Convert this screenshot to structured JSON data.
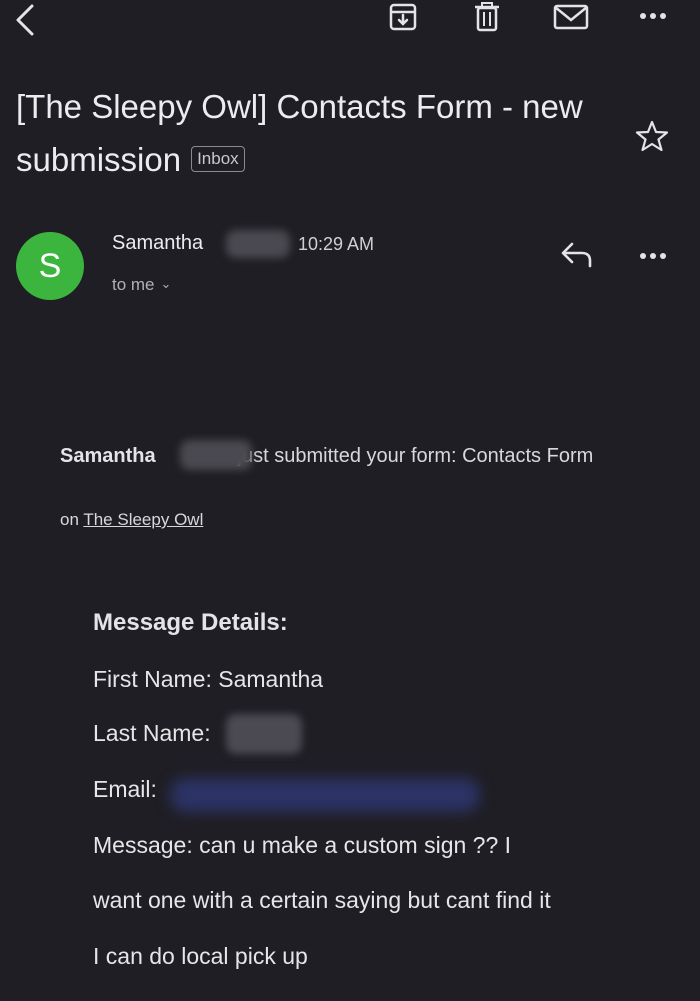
{
  "toolbar": {
    "icons": [
      "back-icon",
      "archive-icon",
      "trash-icon",
      "mail-icon",
      "more-icon"
    ]
  },
  "subject": {
    "title": "[The Sleepy Owl] Contacts Form - new submission",
    "label": "Inbox"
  },
  "message_header": {
    "avatar_letter": "S",
    "avatar_color": "#3cb53f",
    "sender": "Samantha",
    "time": "10:29 AM",
    "recipient": "to me"
  },
  "body": {
    "intro_name": "Samantha",
    "intro_text": "just submitted your form: Contacts Form",
    "on_prefix": "on",
    "site_link": "The Sleepy Owl",
    "details_heading": "Message Details:",
    "first_name_label": "First Name:",
    "first_name_value": "Samantha",
    "last_name_label": "Last Name:",
    "email_label": "Email:",
    "message_label": "Message:",
    "message_line1": "can u make a custom sign ?? I",
    "message_line2": "want one with a certain saying but cant find it",
    "message_line3": "I can do local pick up"
  }
}
